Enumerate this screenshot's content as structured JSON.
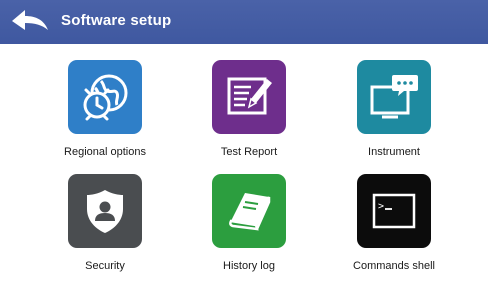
{
  "header": {
    "title": "Software setup",
    "color": "#4660a6"
  },
  "tiles": [
    {
      "label": "Regional options",
      "icon": "globe-clock-icon",
      "color": "#2f7fc8"
    },
    {
      "label": "Test Report",
      "icon": "report-pencil-icon",
      "color": "#6e2e8c"
    },
    {
      "label": "Instrument",
      "icon": "monitor-chat-icon",
      "color": "#1e8aa0"
    },
    {
      "label": "Security",
      "icon": "shield-user-icon",
      "color": "#4a4d50"
    },
    {
      "label": "History log",
      "icon": "book-icon",
      "color": "#2c9e3f"
    },
    {
      "label": "Commands shell",
      "icon": "terminal-icon",
      "color": "#0c0c0c"
    }
  ]
}
